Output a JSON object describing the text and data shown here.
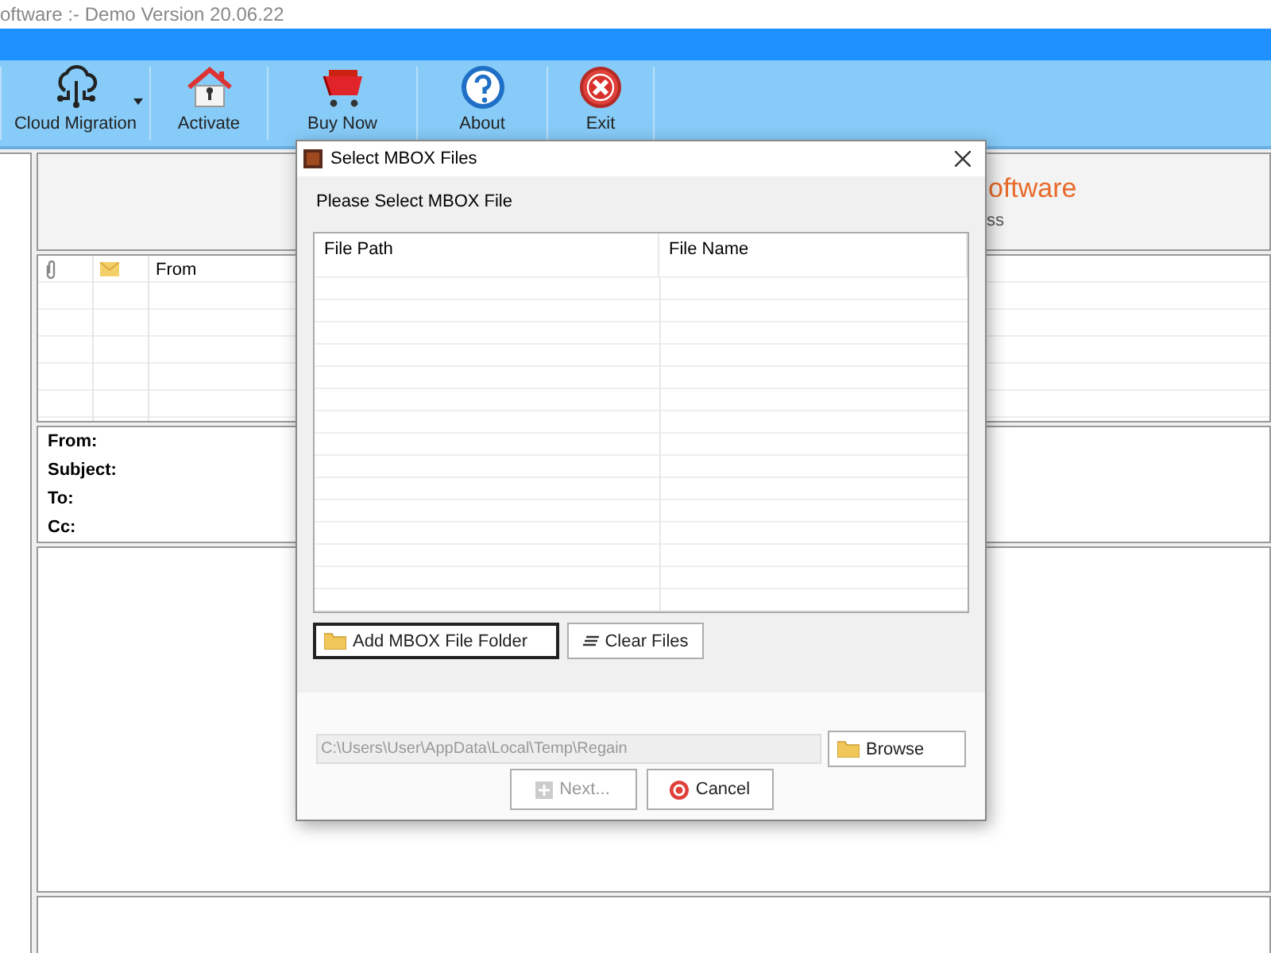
{
  "window": {
    "title": "oftware :- Demo Version 20.06.22"
  },
  "toolbar": [
    {
      "label": "Cloud Migration",
      "kind": "cloud",
      "dropdown": true
    },
    {
      "label": "Activate",
      "kind": "house",
      "dropdown": false
    },
    {
      "label": "Buy Now",
      "kind": "cart",
      "dropdown": false
    },
    {
      "label": "About",
      "kind": "help",
      "dropdown": false
    },
    {
      "label": "Exit",
      "kind": "exit",
      "dropdown": false
    }
  ],
  "banner": {
    "brand": "oftware",
    "tagline": "ss"
  },
  "mail_list": {
    "columns": [
      "From"
    ]
  },
  "details": [
    "From:",
    "Subject:",
    "To:",
    "Cc:"
  ],
  "dialog": {
    "title": "Select MBOX Files",
    "prompt": "Please Select MBOX File",
    "columns": [
      "File Path",
      "File Name"
    ],
    "add_button": {
      "label": "Add MBOX File Folder",
      "focused": true
    },
    "clear_button": {
      "label": "Clear Files"
    },
    "path": {
      "value": "C:\\Users\\User\\AppData\\Local\\Temp\\Regain",
      "disabled": true
    },
    "browse_button": {
      "label": "Browse"
    },
    "next_button": {
      "label": "Next...",
      "disabled": true
    },
    "cancel_button": {
      "label": "Cancel"
    }
  }
}
